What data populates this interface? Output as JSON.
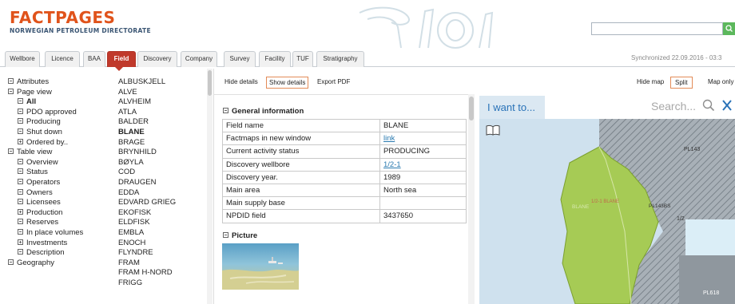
{
  "header": {
    "title": "FACTPAGES",
    "subtitle": "NORWEGIAN PETROLEUM DIRECTORATE",
    "search": {
      "placeholder": "",
      "button_icon": "search-icon"
    }
  },
  "tabs": [
    {
      "label": "Wellbore"
    },
    {
      "label": "Licence"
    },
    {
      "label": "BAA"
    },
    {
      "label": "Field",
      "active": true
    },
    {
      "label": "Discovery"
    },
    {
      "label": "Company"
    },
    {
      "label": "Survey"
    },
    {
      "label": "Facility"
    },
    {
      "label": "TUF"
    },
    {
      "label": "Stratigraphy"
    }
  ],
  "sync_text": "Synchronized 22.09.2016 - 03:3",
  "tree": [
    {
      "label": "Attributes",
      "level": 0,
      "sign": "minus"
    },
    {
      "label": "Page view",
      "level": 0,
      "sign": "minus"
    },
    {
      "label": "All",
      "level": 1,
      "sign": "minus",
      "bold": true
    },
    {
      "label": "PDO approved",
      "level": 1,
      "sign": "minus"
    },
    {
      "label": "Producing",
      "level": 1,
      "sign": "minus"
    },
    {
      "label": "Shut down",
      "level": 1,
      "sign": "minus"
    },
    {
      "label": "Ordered by..",
      "level": 1,
      "sign": "plus"
    },
    {
      "label": "Table view",
      "level": 0,
      "sign": "minus"
    },
    {
      "label": "Overview",
      "level": 1,
      "sign": "minus"
    },
    {
      "label": "Status",
      "level": 1,
      "sign": "minus"
    },
    {
      "label": "Operators",
      "level": 1,
      "sign": "minus"
    },
    {
      "label": "Owners",
      "level": 1,
      "sign": "minus"
    },
    {
      "label": "Licensees",
      "level": 1,
      "sign": "minus"
    },
    {
      "label": "Production",
      "level": 1,
      "sign": "plus"
    },
    {
      "label": "Reserves",
      "level": 1,
      "sign": "minus"
    },
    {
      "label": "In place volumes",
      "level": 1,
      "sign": "minus"
    },
    {
      "label": "Investments",
      "level": 1,
      "sign": "plus"
    },
    {
      "label": "Description",
      "level": 1,
      "sign": "minus"
    },
    {
      "label": "Geography",
      "level": 0,
      "sign": "minus"
    }
  ],
  "fields": [
    "ALBUSKJELL",
    "ALVE",
    "ALVHEIM",
    "ATLA",
    "BALDER",
    "BLANE",
    "BRAGE",
    "BRYNHILD",
    "BØYLA",
    "COD",
    "DRAUGEN",
    "EDDA",
    "EDVARD GRIEG",
    "EKOFISK",
    "ELDFISK",
    "EMBLA",
    "ENOCH",
    "FLYNDRE",
    "FRAM",
    "FRAM H-NORD",
    "FRIGG"
  ],
  "selected_field": "BLANE",
  "detail_toolbar": {
    "hide": "Hide details",
    "show": "Show details",
    "export": "Export PDF"
  },
  "general": {
    "title": "General information",
    "rows": [
      {
        "key": "Field name",
        "value": "BLANE",
        "link": false
      },
      {
        "key": "Factmaps in new window",
        "value": "link",
        "link": true
      },
      {
        "key": "Current activity status",
        "value": "PRODUCING",
        "link": false
      },
      {
        "key": "Discovery wellbore",
        "value": "1/2-1",
        "link": true
      },
      {
        "key": "Discovery year.",
        "value": "1989",
        "link": false
      },
      {
        "key": "Main area",
        "value": "North sea",
        "link": false
      },
      {
        "key": "Main supply base",
        "value": "",
        "link": false
      },
      {
        "key": "NPDID field",
        "value": "3437650",
        "link": false
      }
    ]
  },
  "picture": {
    "title": "Picture"
  },
  "map_toolbar": {
    "hide": "Hide map",
    "split": "Split",
    "only": "Map only"
  },
  "map": {
    "iwant": "I want to...",
    "search": "Search...",
    "labels": [
      "PL143",
      "1/2-1 BLANE",
      "BLANE",
      "PL143BS",
      "1/2",
      "PL618"
    ],
    "colors": {
      "field": "#a6cb55",
      "sea": "#cfe1ee",
      "hatched": "#9aa2aa"
    }
  }
}
